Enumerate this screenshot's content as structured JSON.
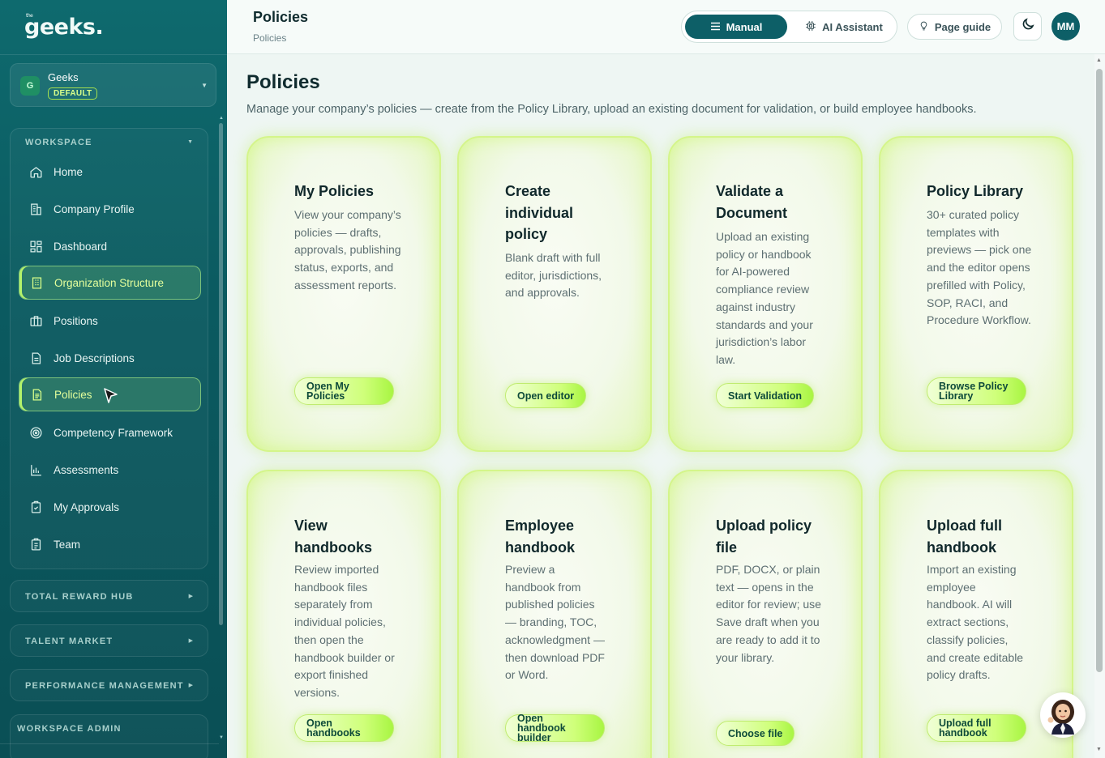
{
  "brand": {
    "logo_small": "the",
    "logo": "geeks."
  },
  "org": {
    "initial": "G",
    "name": "Geeks",
    "badge": "DEFAULT"
  },
  "sidebar": {
    "workspace_label": "WORKSPACE",
    "items": [
      {
        "label": "Home",
        "icon": "home-icon"
      },
      {
        "label": "Company Profile",
        "icon": "building-icon"
      },
      {
        "label": "Dashboard",
        "icon": "grid-icon"
      },
      {
        "label": "Organization Structure",
        "icon": "org-building-icon"
      },
      {
        "label": "Positions",
        "icon": "briefcase-icon"
      },
      {
        "label": "Job Descriptions",
        "icon": "document-icon"
      },
      {
        "label": "Policies",
        "icon": "policy-document-icon"
      },
      {
        "label": "Competency Framework",
        "icon": "target-icon"
      },
      {
        "label": "Assessments",
        "icon": "bar-chart-icon"
      },
      {
        "label": "My Approvals",
        "icon": "clipboard-check-icon"
      },
      {
        "label": "Team",
        "icon": "clipboard-icon"
      }
    ],
    "groups": [
      "TOTAL REWARD HUB",
      "TALENT MARKET",
      "PERFORMANCE MANAGEMENT",
      "WORKSPACE ADMIN"
    ]
  },
  "topbar": {
    "title": "Policies",
    "breadcrumb": "Policies",
    "manual_label": "Manual",
    "ai_label": "AI Assistant",
    "guide_label": "Page guide",
    "user_initials": "MM"
  },
  "page": {
    "title": "Policies",
    "description": "Manage your company’s policies — create from the Policy Library, upload an existing document for validation, or build employee handbooks."
  },
  "cards": [
    {
      "title": "My Policies",
      "desc": "View your company’s policies — drafts, approvals, publishing status, exports, and assessment reports.",
      "button": "Open My Policies"
    },
    {
      "title": "Create individual policy",
      "desc": "Blank draft with full editor, jurisdictions, and approvals.",
      "button": "Open editor"
    },
    {
      "title": "Validate a Document",
      "desc": "Upload an existing policy or handbook for AI-powered compliance review against industry standards and your jurisdiction’s labor law.",
      "button": "Start Validation"
    },
    {
      "title": "Policy Library",
      "desc": "30+ curated policy templates with previews — pick one and the editor opens prefilled with Policy, SOP, RACI, and Procedure Workflow.",
      "button": "Browse Policy Library"
    },
    {
      "title": "View handbooks",
      "desc": "Review imported handbook files separately from individual policies, then open the handbook builder or export finished versions.",
      "button": "Open handbooks"
    },
    {
      "title": "Employee handbook",
      "desc": "Preview a handbook from published policies — branding, TOC, acknowledgment — then download PDF or Word.",
      "button": "Open handbook builder"
    },
    {
      "title": "Upload policy file",
      "desc": "PDF, DOCX, or plain text — opens in the editor for review; use Save draft when you are ready to add it to your library.",
      "button": "Choose file"
    },
    {
      "title": "Upload full handbook",
      "desc": "Import an existing employee handbook. AI will extract sections, classify policies, and create editable policy drafts.",
      "button": "Upload full handbook"
    }
  ]
}
